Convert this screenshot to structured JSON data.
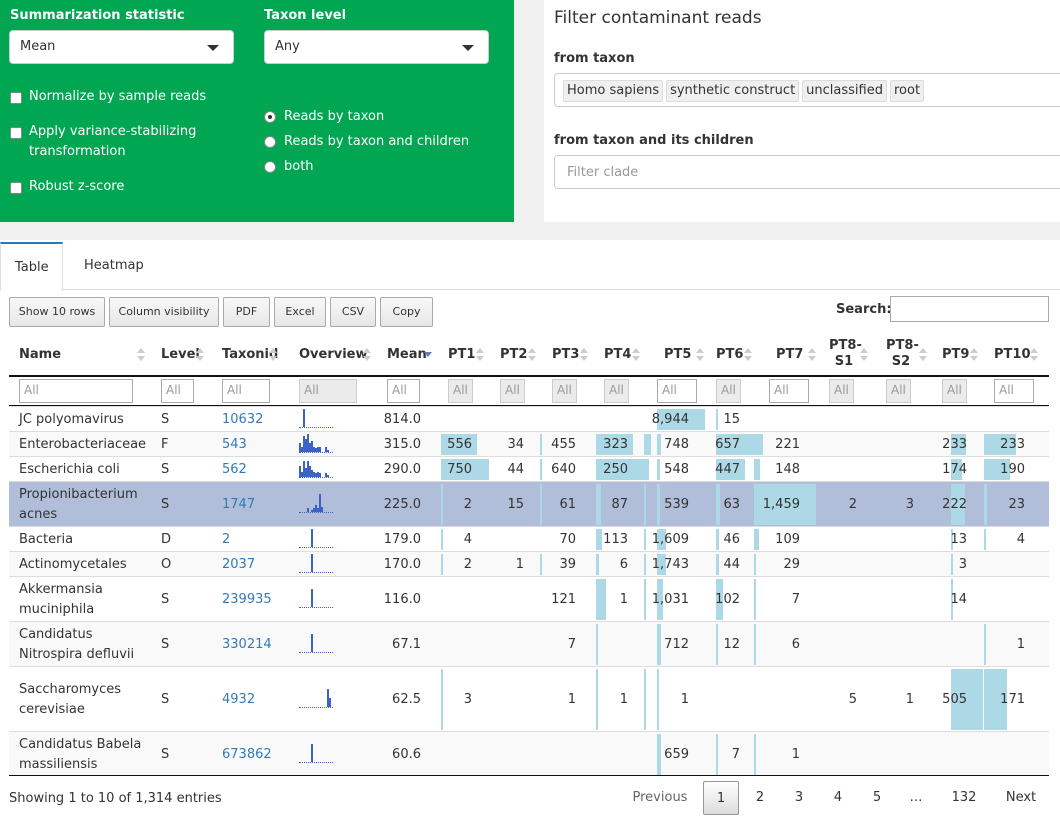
{
  "controls": {
    "summ_label": "Summarization statistic",
    "summ_value": "Mean",
    "taxon_label": "Taxon level",
    "taxon_value": "Any",
    "checkboxes": [
      "Normalize by sample reads",
      "Apply variance-stabilizing",
      "transformation",
      "Robust z-score"
    ],
    "radios": [
      "Reads by taxon",
      "Reads by taxon and children",
      "both"
    ],
    "radio_selected": 0
  },
  "filter": {
    "title": "Filter contaminant reads",
    "from_taxon_label": "from taxon",
    "tags": [
      "Homo sapiens",
      "synthetic construct",
      "unclassified",
      "root"
    ],
    "from_children_label": "from taxon and its children",
    "children_placeholder": "Filter clade"
  },
  "tabs": [
    "Table",
    "Heatmap"
  ],
  "buttons": [
    "Show 10 rows",
    "Column visibility",
    "PDF",
    "Excel",
    "CSV",
    "Copy"
  ],
  "search_label": "Search:",
  "columns": [
    "Name",
    "Level",
    "Taxonid",
    "Overview",
    "Mean",
    "PT1",
    "PT2",
    "PT3",
    "PT4",
    "PT5",
    "PT6",
    "PT7",
    "PT8-",
    "S1",
    "PT8-",
    "S2",
    "PT9",
    "PT10"
  ],
  "filter_placeholder": "All",
  "rows": [
    {
      "name": [
        "JC polyomavirus"
      ],
      "level": "S",
      "taxonid": "10632",
      "mean": "814.0",
      "pt": [
        "",
        "",
        "",
        "",
        "8,944",
        "15",
        "",
        "",
        "",
        "",
        ""
      ]
    },
    {
      "name": [
        "Enterobacteriaceae"
      ],
      "level": "F",
      "taxonid": "543",
      "mean": "315.0",
      "pt": [
        "556",
        "34",
        "455",
        "323",
        "748",
        "657",
        "221",
        "",
        "",
        "233",
        "233"
      ]
    },
    {
      "name": [
        "Escherichia coli"
      ],
      "level": "S",
      "taxonid": "562",
      "mean": "290.0",
      "pt": [
        "750",
        "44",
        "640",
        "250",
        "548",
        "447",
        "148",
        "",
        "",
        "174",
        "190"
      ]
    },
    {
      "name": [
        "Propionibacterium",
        "acnes"
      ],
      "level": "S",
      "taxonid": "1747",
      "mean": "225.0",
      "pt": [
        "2",
        "15",
        "61",
        "87",
        "539",
        "63",
        "1,459",
        "2",
        "3",
        "222",
        "23"
      ]
    },
    {
      "name": [
        "Bacteria"
      ],
      "level": "D",
      "taxonid": "2",
      "mean": "179.0",
      "pt": [
        "4",
        "",
        "70",
        "113",
        "1,609",
        "46",
        "109",
        "",
        "",
        "13",
        "4"
      ]
    },
    {
      "name": [
        "Actinomycetales"
      ],
      "level": "O",
      "taxonid": "2037",
      "mean": "170.0",
      "pt": [
        "2",
        "1",
        "39",
        "6",
        "1,743",
        "44",
        "29",
        "",
        "",
        "3",
        ""
      ]
    },
    {
      "name": [
        "Akkermansia",
        "muciniphila"
      ],
      "level": "S",
      "taxonid": "239935",
      "mean": "116.0",
      "pt": [
        "",
        "",
        "121",
        "1",
        "1,031",
        "102",
        "7",
        "",
        "",
        "14",
        ""
      ]
    },
    {
      "name": [
        "Candidatus",
        "Nitrospira defluvii"
      ],
      "level": "S",
      "taxonid": "330214",
      "mean": "67.1",
      "pt": [
        "",
        "",
        "7",
        "",
        "712",
        "12",
        "6",
        "",
        "",
        "",
        "1"
      ]
    },
    {
      "name": [
        "Saccharomyces",
        "cerevisiae"
      ],
      "level": "S",
      "taxonid": "4932",
      "mean": "62.5",
      "pt": [
        "3",
        "",
        "1",
        "1",
        "1",
        "",
        "",
        "5",
        "1",
        "505",
        "171"
      ]
    },
    {
      "name": [
        "Candidatus Babela",
        "massiliensis"
      ],
      "level": "S",
      "taxonid": "673862",
      "mean": "60.6",
      "pt": [
        "",
        "",
        "",
        "",
        "659",
        "7",
        "1",
        "",
        "",
        "",
        ""
      ]
    }
  ],
  "footer": {
    "info": "Showing 1 to 10 of 1,314 entries",
    "previous": "Previous",
    "pages": [
      "1",
      "2",
      "3",
      "4",
      "5",
      "…",
      "132"
    ],
    "next": "Next"
  }
}
